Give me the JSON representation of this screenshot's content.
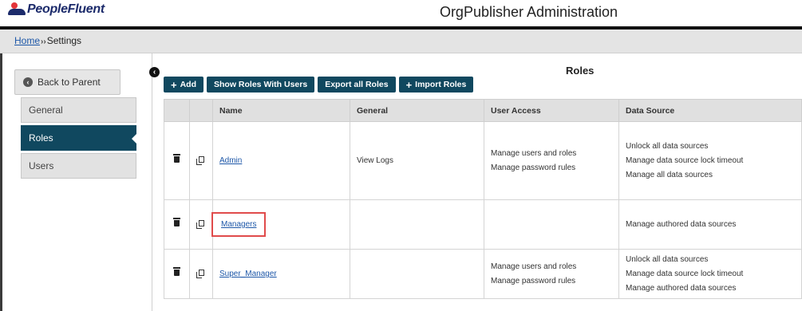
{
  "header": {
    "brand": "PeopleFluent",
    "title": "OrgPublisher Administration",
    "colors": {
      "brand_red": "#e3343a",
      "brand_navy": "#1c2b6b",
      "accent": "#10485f"
    }
  },
  "breadcrumb": {
    "home": "Home",
    "separator": "››",
    "current": "Settings"
  },
  "sidebar": {
    "back": "Back to Parent",
    "items": [
      {
        "label": "General",
        "active": false
      },
      {
        "label": "Roles",
        "active": true
      },
      {
        "label": "Users",
        "active": false
      }
    ]
  },
  "main": {
    "title": "Roles",
    "toolbar": {
      "add": "Add",
      "show_roles": "Show Roles With Users",
      "export": "Export all Roles",
      "import": "Import Roles"
    },
    "table": {
      "headers": [
        "",
        "",
        "Name",
        "General",
        "User Access",
        "Data Source"
      ],
      "rows": [
        {
          "name": "Admin",
          "general": "View Logs",
          "user_access": [
            "Manage users and roles",
            "Manage password rules"
          ],
          "data_source": [
            "Unlock all data sources",
            "Manage data source lock timeout",
            "Manage all data sources"
          ]
        },
        {
          "name": "Managers",
          "general": "",
          "user_access": [],
          "data_source": [
            "Manage authored data sources"
          ],
          "highlighted": true
        },
        {
          "name": "Super_Manager",
          "general": "",
          "user_access": [
            "Manage users and roles",
            "Manage password rules"
          ],
          "data_source": [
            "Unlock all data sources",
            "Manage data source lock timeout",
            "Manage authored data sources"
          ]
        }
      ]
    }
  }
}
